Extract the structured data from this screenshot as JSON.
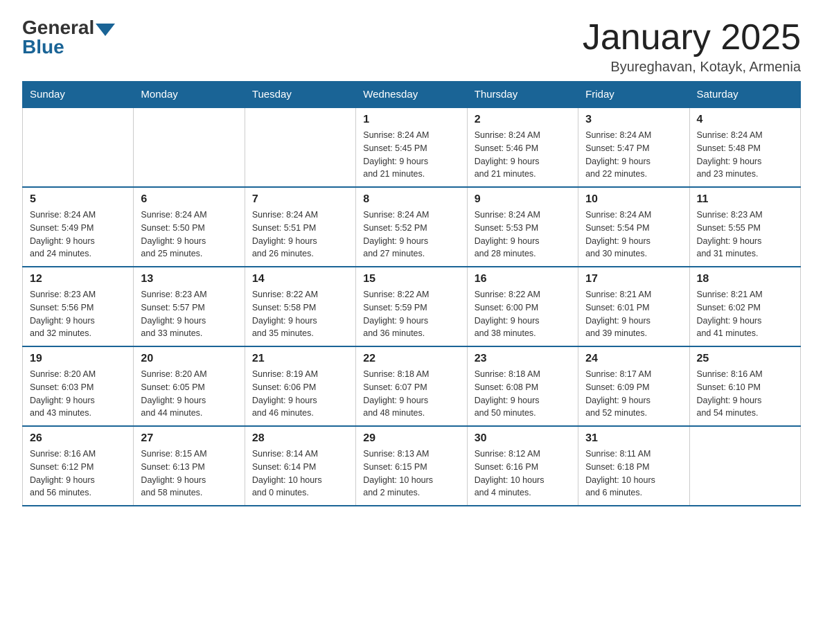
{
  "header": {
    "logo_general": "General",
    "logo_blue": "Blue",
    "month_title": "January 2025",
    "location": "Byureghavan, Kotayk, Armenia"
  },
  "weekdays": [
    "Sunday",
    "Monday",
    "Tuesday",
    "Wednesday",
    "Thursday",
    "Friday",
    "Saturday"
  ],
  "weeks": [
    [
      {
        "day": "",
        "info": ""
      },
      {
        "day": "",
        "info": ""
      },
      {
        "day": "",
        "info": ""
      },
      {
        "day": "1",
        "info": "Sunrise: 8:24 AM\nSunset: 5:45 PM\nDaylight: 9 hours\nand 21 minutes."
      },
      {
        "day": "2",
        "info": "Sunrise: 8:24 AM\nSunset: 5:46 PM\nDaylight: 9 hours\nand 21 minutes."
      },
      {
        "day": "3",
        "info": "Sunrise: 8:24 AM\nSunset: 5:47 PM\nDaylight: 9 hours\nand 22 minutes."
      },
      {
        "day": "4",
        "info": "Sunrise: 8:24 AM\nSunset: 5:48 PM\nDaylight: 9 hours\nand 23 minutes."
      }
    ],
    [
      {
        "day": "5",
        "info": "Sunrise: 8:24 AM\nSunset: 5:49 PM\nDaylight: 9 hours\nand 24 minutes."
      },
      {
        "day": "6",
        "info": "Sunrise: 8:24 AM\nSunset: 5:50 PM\nDaylight: 9 hours\nand 25 minutes."
      },
      {
        "day": "7",
        "info": "Sunrise: 8:24 AM\nSunset: 5:51 PM\nDaylight: 9 hours\nand 26 minutes."
      },
      {
        "day": "8",
        "info": "Sunrise: 8:24 AM\nSunset: 5:52 PM\nDaylight: 9 hours\nand 27 minutes."
      },
      {
        "day": "9",
        "info": "Sunrise: 8:24 AM\nSunset: 5:53 PM\nDaylight: 9 hours\nand 28 minutes."
      },
      {
        "day": "10",
        "info": "Sunrise: 8:24 AM\nSunset: 5:54 PM\nDaylight: 9 hours\nand 30 minutes."
      },
      {
        "day": "11",
        "info": "Sunrise: 8:23 AM\nSunset: 5:55 PM\nDaylight: 9 hours\nand 31 minutes."
      }
    ],
    [
      {
        "day": "12",
        "info": "Sunrise: 8:23 AM\nSunset: 5:56 PM\nDaylight: 9 hours\nand 32 minutes."
      },
      {
        "day": "13",
        "info": "Sunrise: 8:23 AM\nSunset: 5:57 PM\nDaylight: 9 hours\nand 33 minutes."
      },
      {
        "day": "14",
        "info": "Sunrise: 8:22 AM\nSunset: 5:58 PM\nDaylight: 9 hours\nand 35 minutes."
      },
      {
        "day": "15",
        "info": "Sunrise: 8:22 AM\nSunset: 5:59 PM\nDaylight: 9 hours\nand 36 minutes."
      },
      {
        "day": "16",
        "info": "Sunrise: 8:22 AM\nSunset: 6:00 PM\nDaylight: 9 hours\nand 38 minutes."
      },
      {
        "day": "17",
        "info": "Sunrise: 8:21 AM\nSunset: 6:01 PM\nDaylight: 9 hours\nand 39 minutes."
      },
      {
        "day": "18",
        "info": "Sunrise: 8:21 AM\nSunset: 6:02 PM\nDaylight: 9 hours\nand 41 minutes."
      }
    ],
    [
      {
        "day": "19",
        "info": "Sunrise: 8:20 AM\nSunset: 6:03 PM\nDaylight: 9 hours\nand 43 minutes."
      },
      {
        "day": "20",
        "info": "Sunrise: 8:20 AM\nSunset: 6:05 PM\nDaylight: 9 hours\nand 44 minutes."
      },
      {
        "day": "21",
        "info": "Sunrise: 8:19 AM\nSunset: 6:06 PM\nDaylight: 9 hours\nand 46 minutes."
      },
      {
        "day": "22",
        "info": "Sunrise: 8:18 AM\nSunset: 6:07 PM\nDaylight: 9 hours\nand 48 minutes."
      },
      {
        "day": "23",
        "info": "Sunrise: 8:18 AM\nSunset: 6:08 PM\nDaylight: 9 hours\nand 50 minutes."
      },
      {
        "day": "24",
        "info": "Sunrise: 8:17 AM\nSunset: 6:09 PM\nDaylight: 9 hours\nand 52 minutes."
      },
      {
        "day": "25",
        "info": "Sunrise: 8:16 AM\nSunset: 6:10 PM\nDaylight: 9 hours\nand 54 minutes."
      }
    ],
    [
      {
        "day": "26",
        "info": "Sunrise: 8:16 AM\nSunset: 6:12 PM\nDaylight: 9 hours\nand 56 minutes."
      },
      {
        "day": "27",
        "info": "Sunrise: 8:15 AM\nSunset: 6:13 PM\nDaylight: 9 hours\nand 58 minutes."
      },
      {
        "day": "28",
        "info": "Sunrise: 8:14 AM\nSunset: 6:14 PM\nDaylight: 10 hours\nand 0 minutes."
      },
      {
        "day": "29",
        "info": "Sunrise: 8:13 AM\nSunset: 6:15 PM\nDaylight: 10 hours\nand 2 minutes."
      },
      {
        "day": "30",
        "info": "Sunrise: 8:12 AM\nSunset: 6:16 PM\nDaylight: 10 hours\nand 4 minutes."
      },
      {
        "day": "31",
        "info": "Sunrise: 8:11 AM\nSunset: 6:18 PM\nDaylight: 10 hours\nand 6 minutes."
      },
      {
        "day": "",
        "info": ""
      }
    ]
  ]
}
